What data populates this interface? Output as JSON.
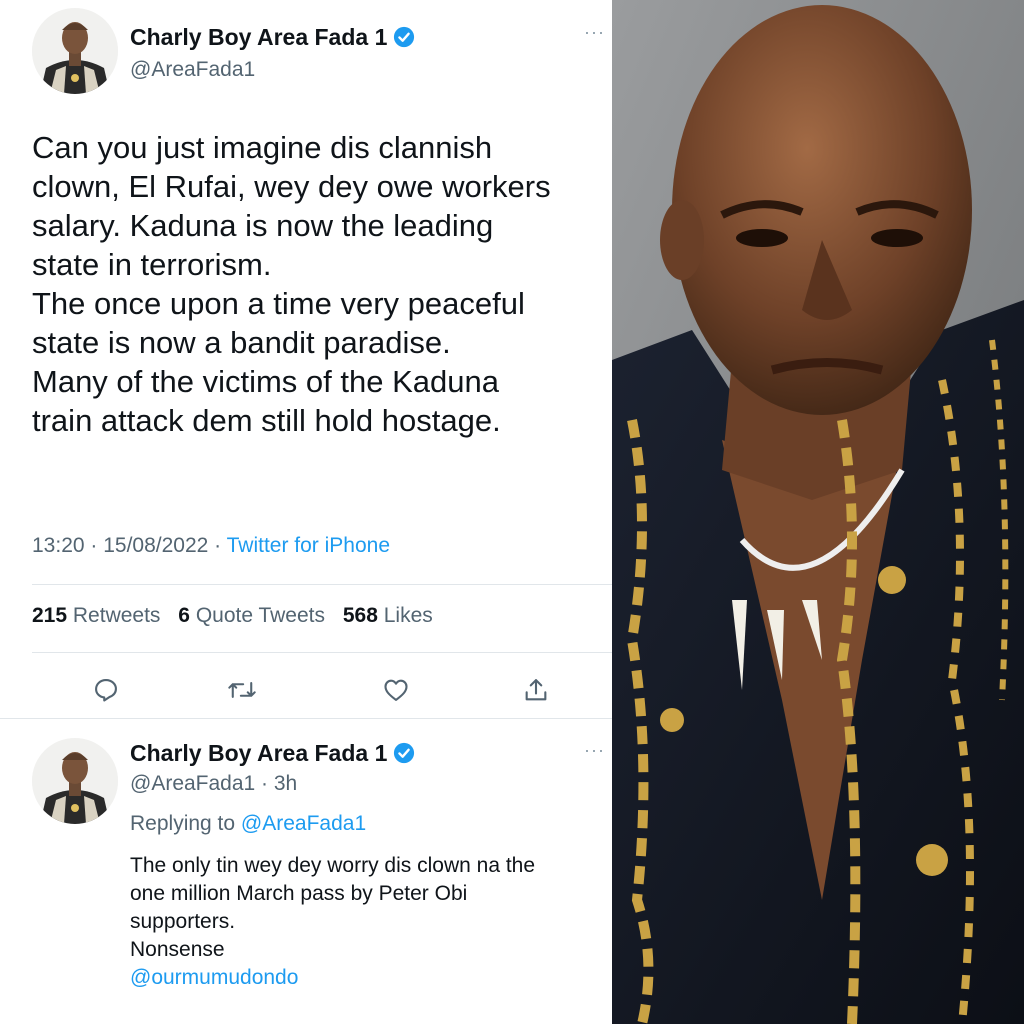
{
  "tweet": {
    "author_name": "Charly Boy Area Fada 1",
    "handle": "@AreaFada1",
    "more_label": "···",
    "text_lines": [
      "Can you just imagine dis clannish",
      "clown, El Rufai, wey dey owe workers",
      "salary. Kaduna is now the leading",
      "state in terrorism.",
      "The once upon a time very peaceful",
      "state is now a bandit paradise.",
      "Many of the victims of the Kaduna",
      "train attack dem still hold hostage."
    ],
    "time": "13:20 · 15/08/2022 · ",
    "source": "Twitter for iPhone",
    "retweets_count": "215",
    "retweets_label": "Retweets",
    "quotes_count": "6",
    "quotes_label": "Quote Tweets",
    "likes_count": "568",
    "likes_label": "Likes"
  },
  "reply": {
    "author_name": "Charly Boy Area Fada 1",
    "handle_time": "@AreaFada1 · 3h",
    "more_label": "···",
    "replying_prefix": "Replying to ",
    "replying_to": "@AreaFada1",
    "text_lines": [
      "The only tin wey dey worry dis clown na the",
      "one million March pass by Peter Obi",
      "supporters.",
      "Nonsense"
    ],
    "mention": "@ourmumudondo"
  },
  "colors": {
    "accent": "#1d9bf0",
    "text": "#0f1419",
    "muted": "#536471"
  },
  "icons": [
    "verified-badge-icon",
    "reply-icon",
    "retweet-icon",
    "like-icon",
    "share-icon",
    "more-icon"
  ]
}
